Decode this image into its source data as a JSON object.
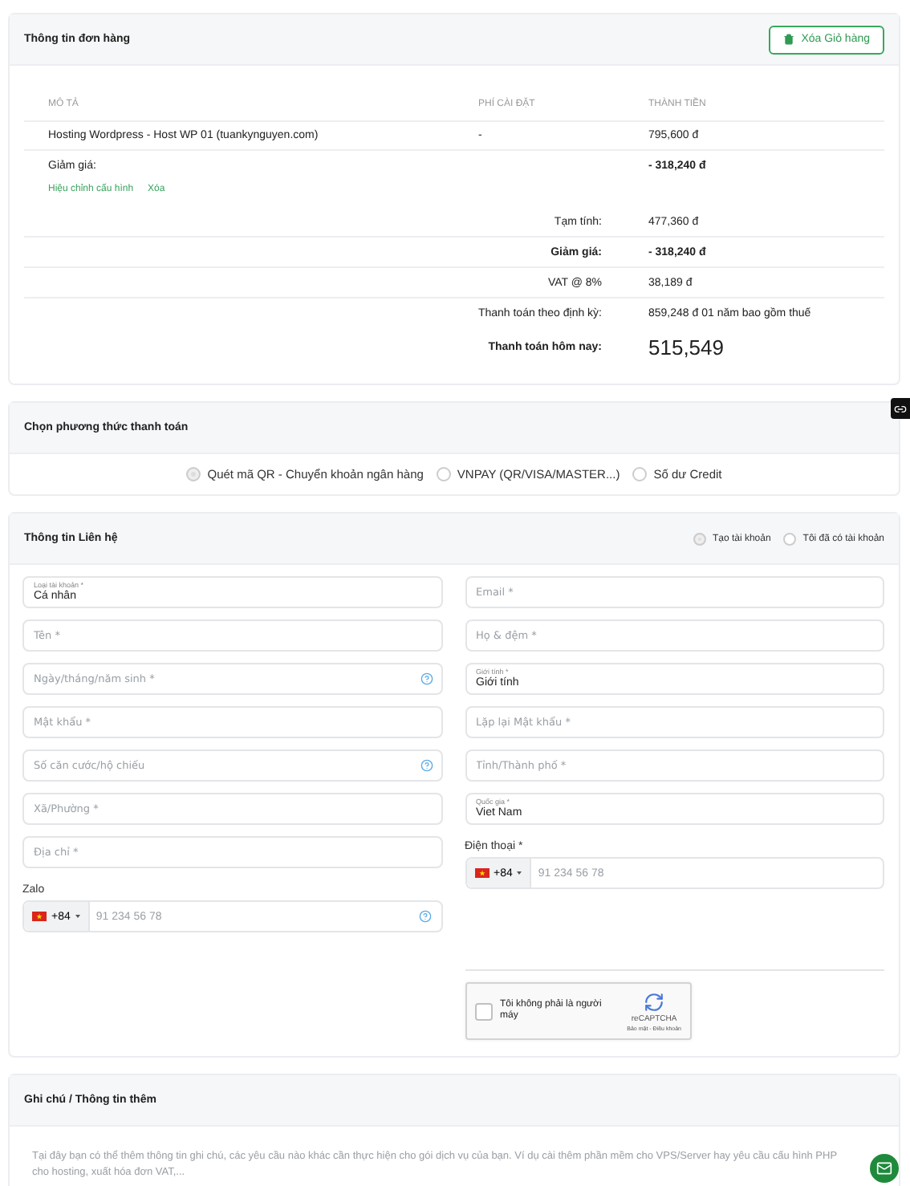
{
  "order": {
    "title": "Thông tin đơn hàng",
    "clear_button": "Xóa Giỏ hàng",
    "columns": [
      "MÔ TẢ",
      "PHÍ CÀI ĐẶT",
      "THÀNH TIỀN"
    ],
    "items": [
      {
        "description": "Hosting Wordpress - Host WP 01 (tuankynguyen.com)",
        "setup_fee": "-",
        "amount": "795,600 đ"
      }
    ],
    "discount": {
      "label": "Giảm giá:",
      "amount": "- 318,240 đ"
    },
    "links": [
      "Hiệu chỉnh cấu hình",
      "Xóa"
    ],
    "summary": [
      {
        "kind": "normal",
        "label": "Tạm tính:",
        "value": "477,360 đ"
      },
      {
        "kind": "bold",
        "label": "Giảm giá:",
        "value": "- 318,240 đ"
      },
      {
        "kind": "normal",
        "label": "VAT @ 8%",
        "value": "38,189 đ"
      },
      {
        "kind": "normal",
        "label": "Thanh toán theo định kỳ:",
        "value": "859,248 đ 01 năm bao gồm thuế"
      },
      {
        "kind": "total",
        "label": "Thanh toán hôm nay:",
        "value": "515,549"
      }
    ]
  },
  "payment": {
    "title": "Chọn phương thức thanh toán",
    "options": [
      {
        "label": "Quét mã QR - Chuyển khoản ngân hàng",
        "selected": true
      },
      {
        "label": "VNPAY (QR/VISA/MASTER...)",
        "selected": false
      },
      {
        "label": "Số dư Credit",
        "selected": false
      }
    ]
  },
  "contact": {
    "title": "Thông tin Liên hệ",
    "account_options": [
      {
        "label": "Tạo tài khoản",
        "selected": true
      },
      {
        "label": "Tôi đã có tài khoản",
        "selected": false
      }
    ],
    "left": [
      {
        "kind": "select",
        "label": "Loại tài khoản *",
        "value": "Cá nhân"
      },
      {
        "kind": "text",
        "placeholder": "Tên *"
      },
      {
        "kind": "text",
        "placeholder": "Ngày/tháng/năm sinh *",
        "help": true
      },
      {
        "kind": "text",
        "placeholder": "Mật khẩu *"
      },
      {
        "kind": "text",
        "placeholder": "Số căn cước/hộ chiếu",
        "help": true
      },
      {
        "kind": "text",
        "placeholder": "Xã/Phường *"
      },
      {
        "kind": "text",
        "placeholder": "Địa chỉ *"
      },
      {
        "kind": "phone",
        "label": "Zalo",
        "code": "+84",
        "placeholder": "91 234 56 78",
        "help": true
      }
    ],
    "right": [
      {
        "kind": "text",
        "placeholder": "Email *"
      },
      {
        "kind": "text",
        "placeholder": "Họ & đệm *"
      },
      {
        "kind": "select",
        "label": "Giới tính *",
        "value": "Giới tính"
      },
      {
        "kind": "text",
        "placeholder": "Lặp lại Mật khẩu *"
      },
      {
        "kind": "text",
        "placeholder": "Tỉnh/Thành phố *"
      },
      {
        "kind": "select",
        "label": "Quốc gia *",
        "value": "Viet Nam"
      },
      {
        "kind": "phone",
        "label": "Điện thoại *",
        "code": "+84",
        "placeholder": "91 234 56 78"
      }
    ],
    "captcha": {
      "label": "Tôi không phải là người máy",
      "brand": "reCAPTCHA",
      "terms": "Bảo mật - Điều khoản",
      "checked": false
    }
  },
  "notes": {
    "title": "Ghi chú / Thông tin thêm",
    "placeholder": "Tại đây bạn có thể thêm thông tin ghi chú, các yêu cầu nào khác cần thực hiện cho gói dịch vụ của bạn. Ví dụ cài thêm phần mềm cho VPS/Server hay yêu cầu cấu hình PHP cho hosting, xuất hóa đơn VAT,..."
  }
}
